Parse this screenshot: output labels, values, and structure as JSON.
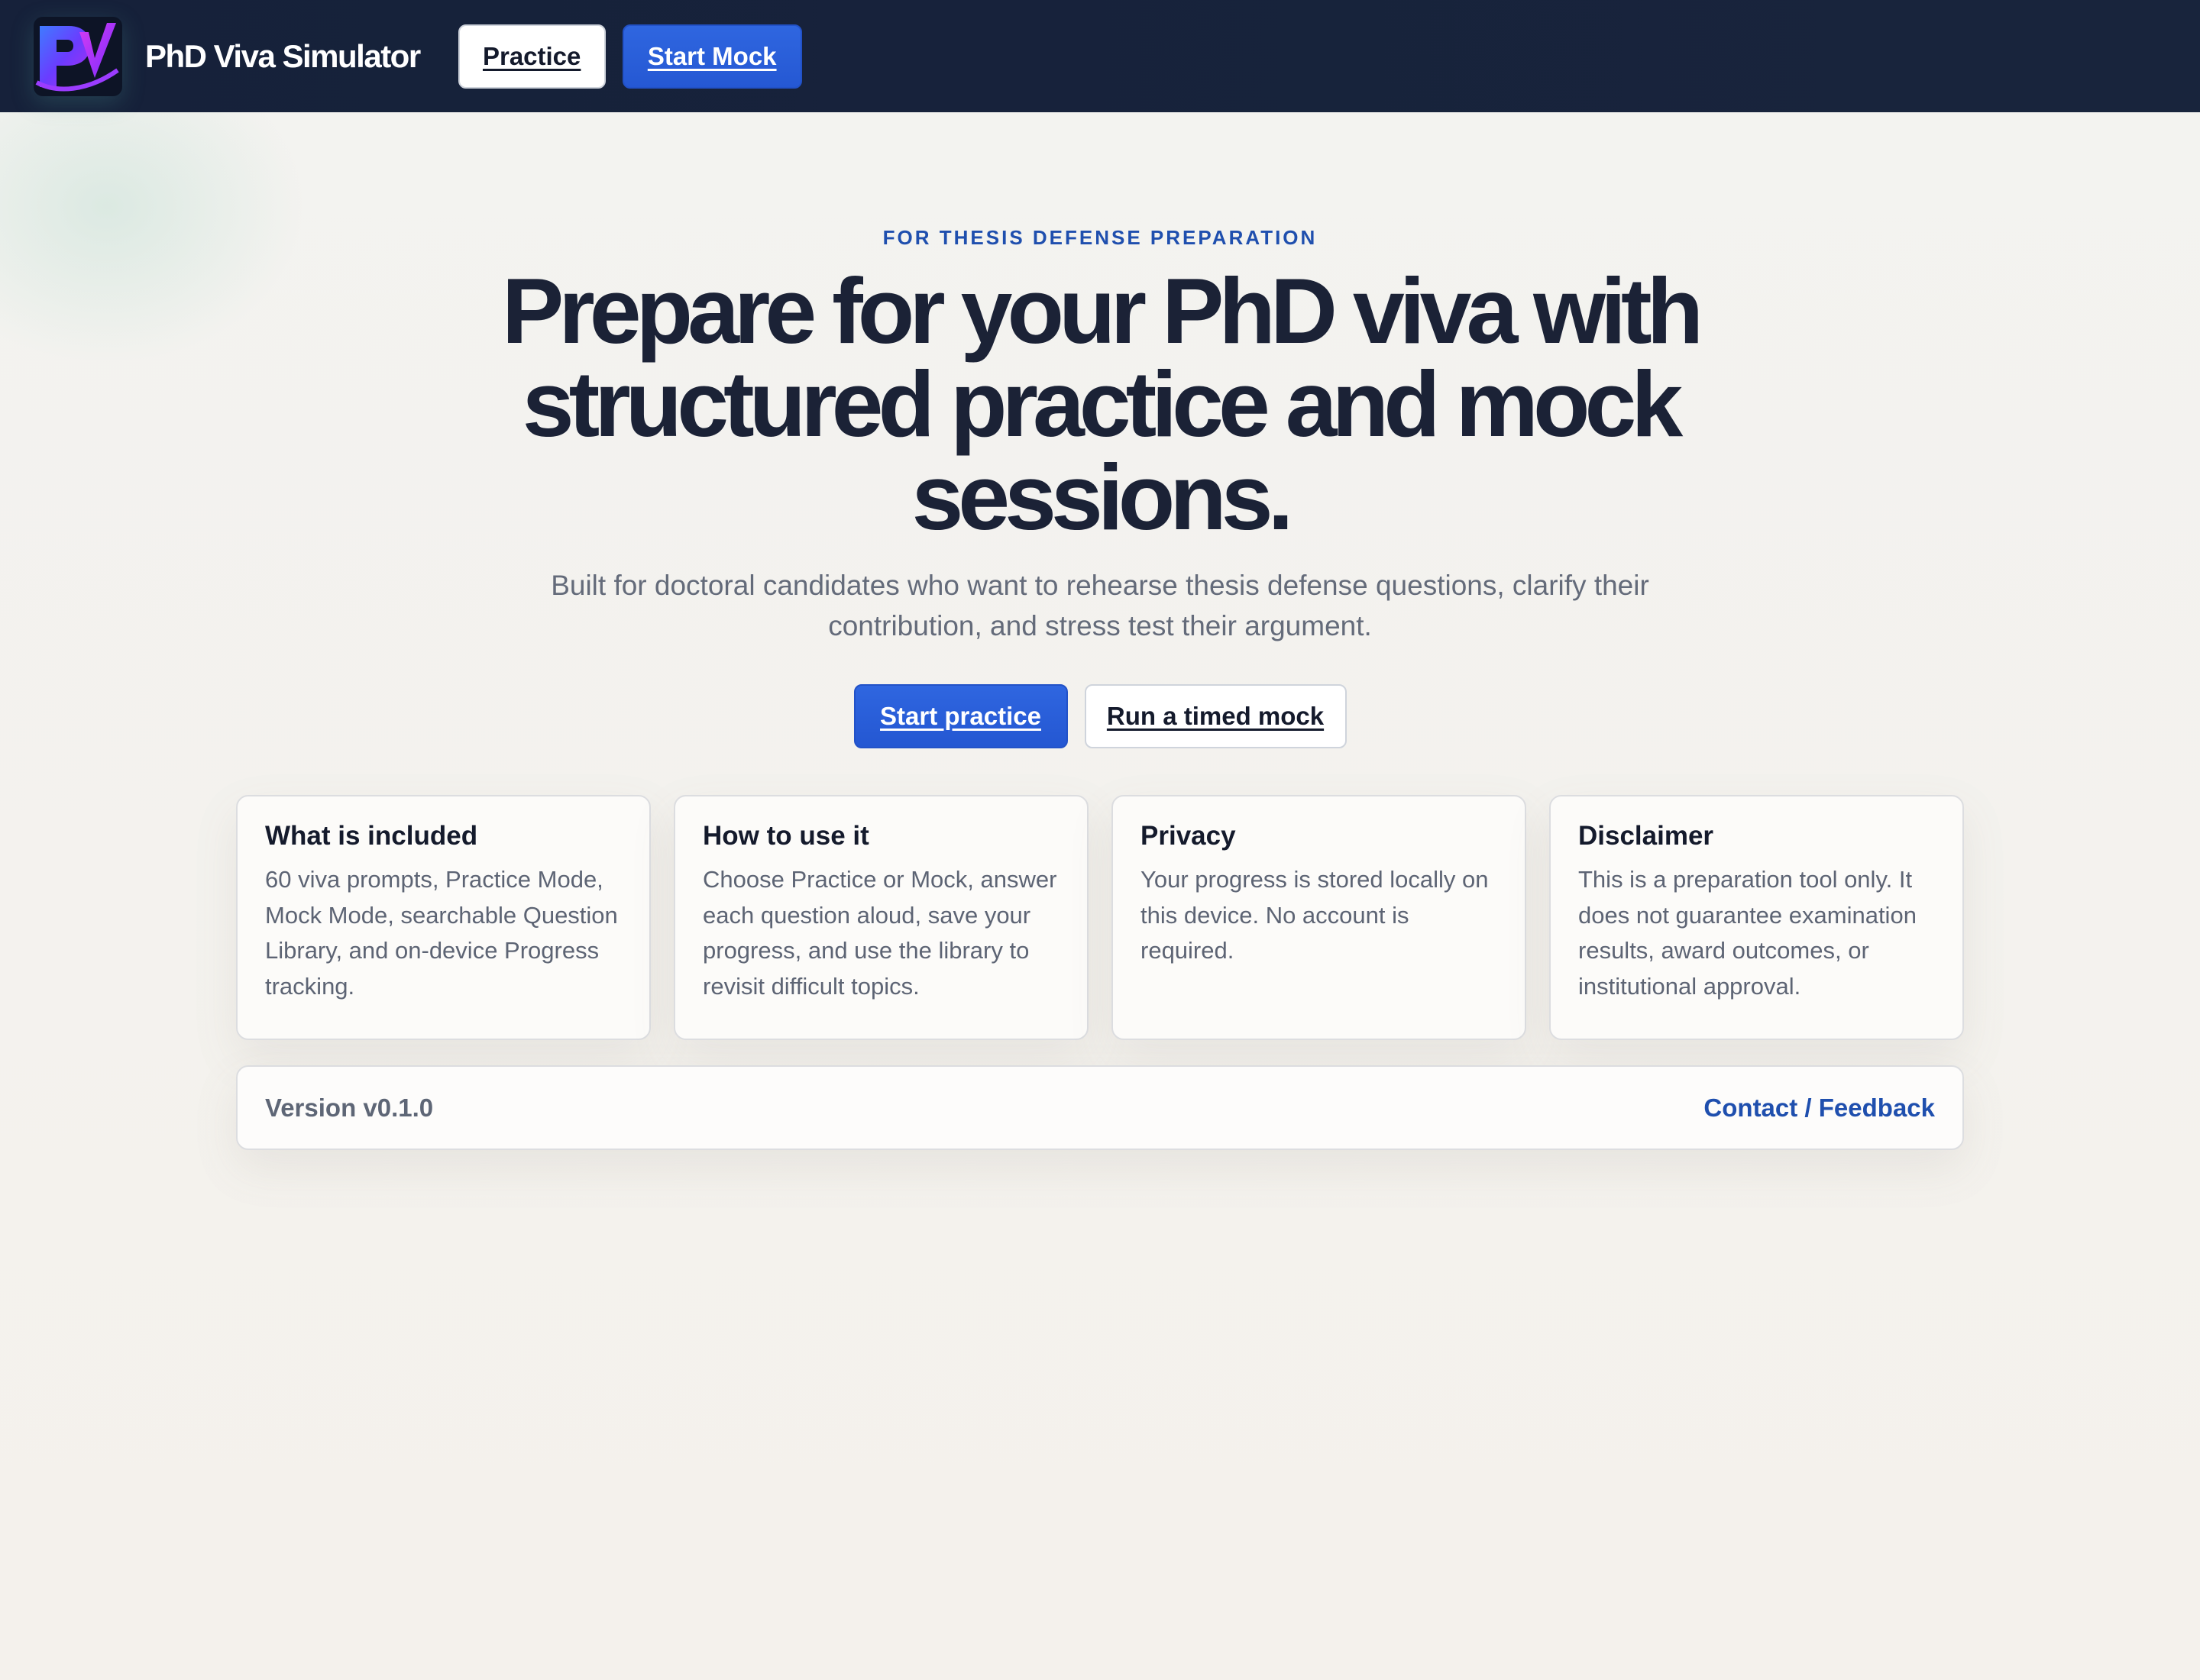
{
  "header": {
    "brand": "PhD Viva Simulator",
    "nav": {
      "practice_label": "Practice",
      "start_mock_label": "Start Mock"
    }
  },
  "hero": {
    "eyebrow": "FOR THESIS DEFENSE PREPARATION",
    "title": "Prepare for your PhD viva with structured practice and mock sessions.",
    "subtitle": "Built for doctoral candidates who want to rehearse thesis defense questions, clarify their contribution, and stress test their argument.",
    "primary_cta": "Start practice",
    "secondary_cta": "Run a timed mock"
  },
  "cards": [
    {
      "title": "What is included",
      "body": "60 viva prompts, Practice Mode, Mock Mode, searchable Question Library, and on-device Progress tracking."
    },
    {
      "title": "How to use it",
      "body": "Choose Practice or Mock, answer each question aloud, save your progress, and use the library to revisit difficult topics."
    },
    {
      "title": "Privacy",
      "body": "Your progress is stored locally on this device. No account is required."
    },
    {
      "title": "Disclaimer",
      "body": "This is a preparation tool only. It does not guarantee examination results, award outcomes, or institutional approval."
    }
  ],
  "footer": {
    "version": "Version v0.1.0",
    "contact": "Contact / Feedback"
  },
  "colors": {
    "header_bg": "#16213a",
    "accent_blue": "#2558d3",
    "eyebrow_blue": "#1f4fae",
    "heading": "#1b2236",
    "body_text": "#646b7a"
  },
  "icons": {
    "logo": "pv-logo-icon"
  }
}
